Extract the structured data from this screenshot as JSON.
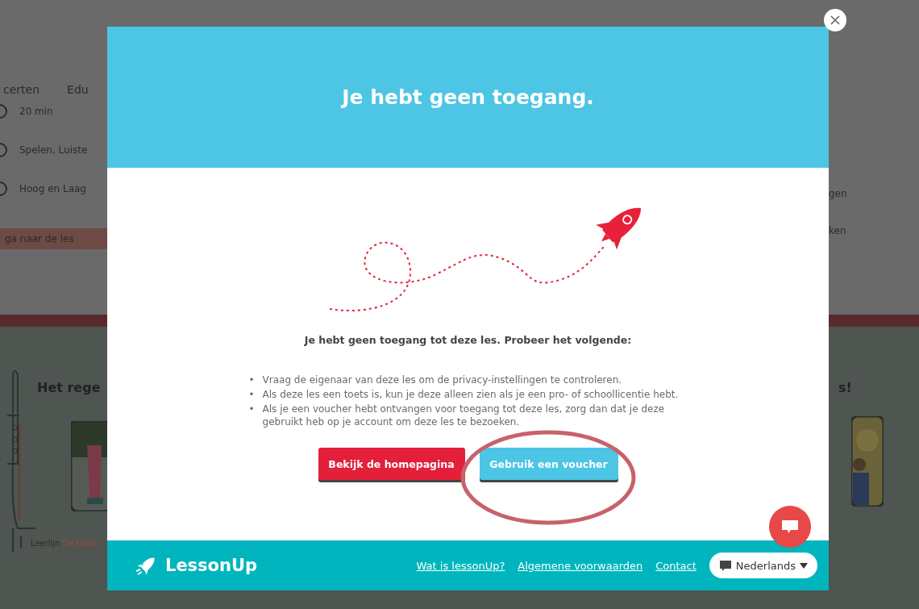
{
  "background_page": {
    "nav": [
      "certen",
      "Edu"
    ],
    "details": [
      "20 min",
      "Spelen, Luiste",
      "Hoog en Laag"
    ],
    "lesson_button": "ga naar de les",
    "right_details": [
      "gen",
      "ken"
    ],
    "section_title": "Het rege",
    "right_title": "s!",
    "series_label": "Leerlijn",
    "series_link": "De krach"
  },
  "dialog": {
    "title": "Je hebt geen toegang.",
    "heading": "Je hebt geen toegang tot deze les. Probeer het volgende:",
    "bullet": "•",
    "suggestions": [
      "Vraag de eigenaar van deze les om de privacy-instellingen te controleren.",
      "Als deze les een toets is, kun je deze alleen zien als je een pro- of schoollicentie hebt.",
      "Als je een voucher hebt ontvangen voor toegang tot deze les, zorg dan dat je deze gebruikt heb op je account om deze les te bezoeken."
    ],
    "buttons": [
      {
        "label": "Bekijk de homepagina",
        "kind": "primary"
      },
      {
        "label": "Gebruik een voucher",
        "kind": "secondary"
      }
    ]
  },
  "footer": {
    "brand": "LessonUp",
    "links": [
      "Wat is lessonUp?",
      "Algemene voorwaarden",
      "Contact"
    ],
    "language": "Nederlands"
  }
}
